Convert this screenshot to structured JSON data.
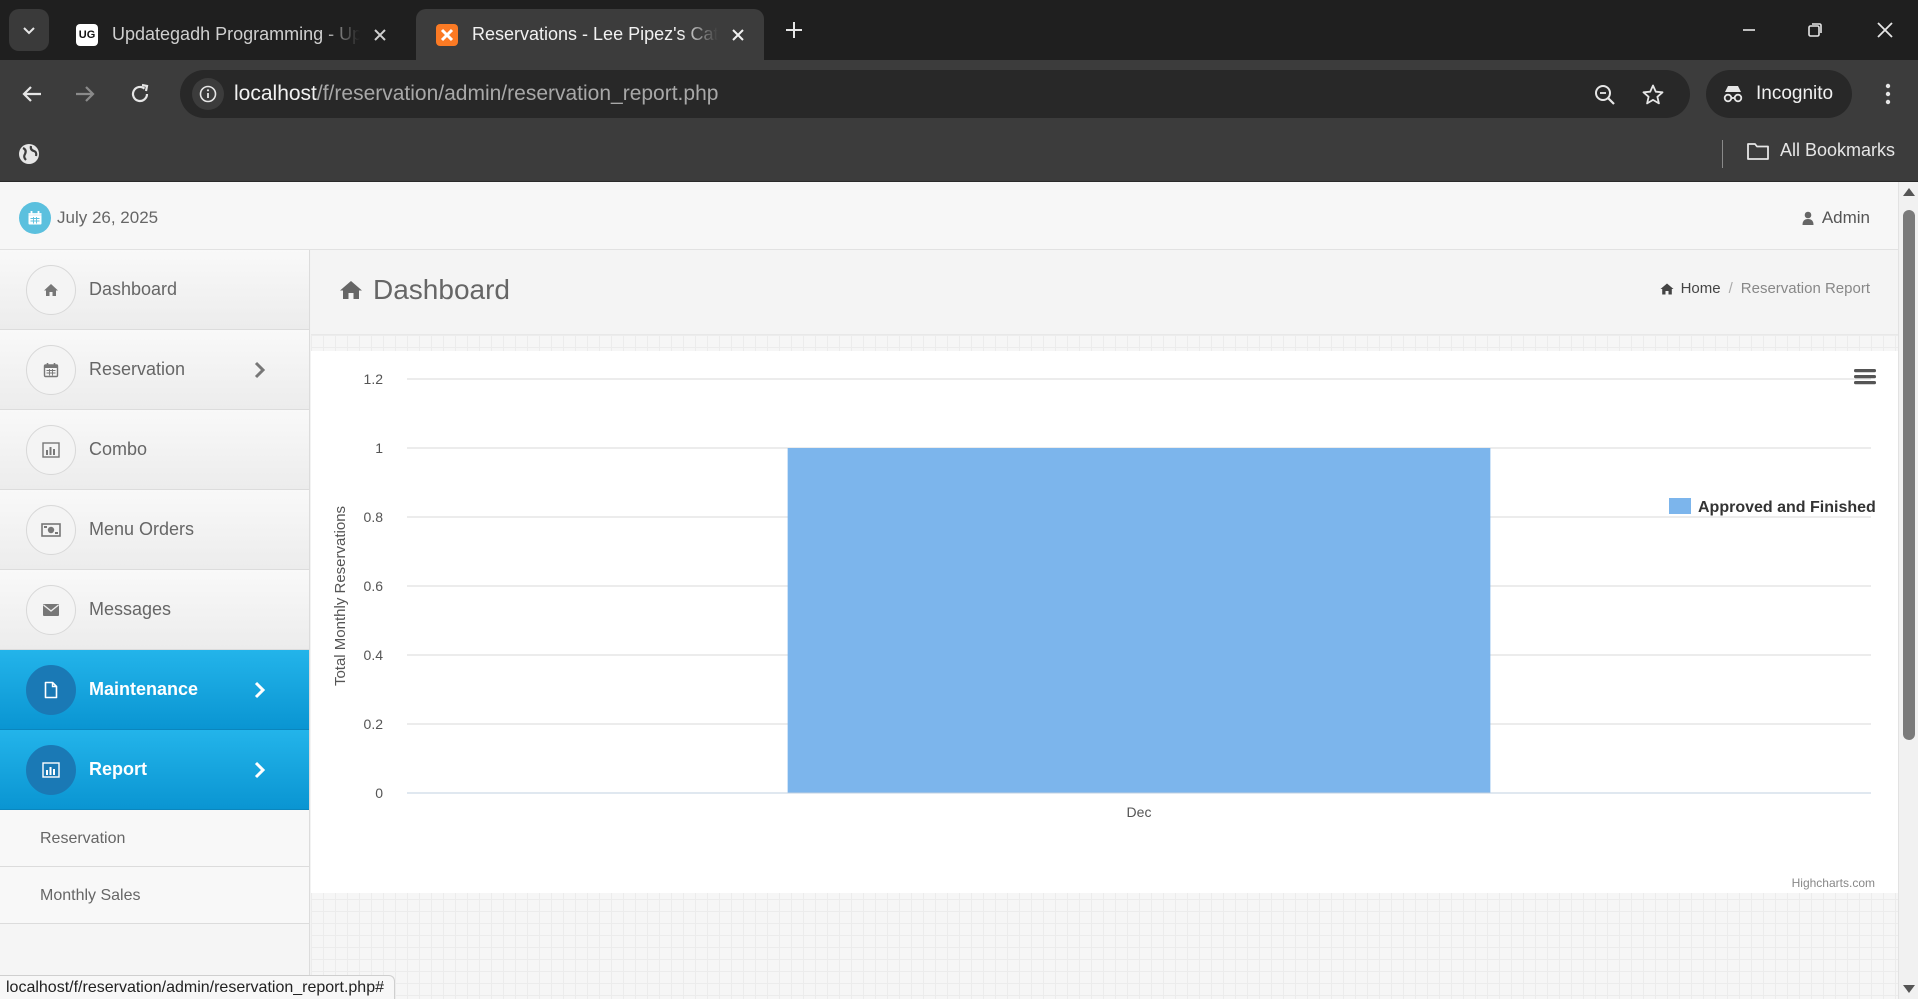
{
  "browser": {
    "tabs": [
      {
        "title": "Updategadh Programming - Up",
        "favicon": "UG"
      },
      {
        "title": "Reservations - Lee Pipez's Cater",
        "favicon": "XAMPP"
      }
    ],
    "url_host": "localhost",
    "url_path": "/f/reservation/admin/reservation_report.php",
    "incognito_label": "Incognito",
    "bookmarks_label": "All Bookmarks"
  },
  "topbar": {
    "date": "July 26, 2025",
    "user": "Admin"
  },
  "sidebar": {
    "items": [
      {
        "label": "Dashboard",
        "icon": "home-icon",
        "active": false,
        "chevron": false
      },
      {
        "label": "Reservation",
        "icon": "calendar-icon",
        "active": false,
        "chevron": true
      },
      {
        "label": "Combo",
        "icon": "bar-chart-icon",
        "active": false,
        "chevron": false
      },
      {
        "label": "Menu Orders",
        "icon": "money-icon",
        "active": false,
        "chevron": false
      },
      {
        "label": "Messages",
        "icon": "envelope-icon",
        "active": false,
        "chevron": false
      },
      {
        "label": "Maintenance",
        "icon": "file-icon",
        "active": true,
        "chevron": true
      },
      {
        "label": "Report",
        "icon": "bar-chart-icon",
        "active": true,
        "chevron": true
      }
    ],
    "subitems": [
      {
        "label": "Reservation"
      },
      {
        "label": "Monthly Sales"
      }
    ]
  },
  "content": {
    "title": "Dashboard",
    "breadcrumb_home": "Home",
    "breadcrumb_current": "Reservation Report"
  },
  "chart_data": {
    "type": "bar",
    "categories": [
      "Dec"
    ],
    "series": [
      {
        "name": "Approved and Finished",
        "values": [
          1
        ],
        "color": "#7cb5ec"
      }
    ],
    "ylabel": "Total Monthly Reservations",
    "xlabel": "",
    "ylim": [
      0,
      1.2
    ],
    "yticks": [
      "0",
      "0.2",
      "0.4",
      "0.6",
      "0.8",
      "1",
      "1.2"
    ],
    "grid": true,
    "legend_position": "right",
    "credits": "Highcharts.com"
  },
  "statusbar": {
    "url": "localhost/f/reservation/admin/reservation_report.php#"
  },
  "colors": {
    "accent": "#0a95d2",
    "date_icon": "#5bc0de",
    "bar": "#7cb5ec"
  }
}
